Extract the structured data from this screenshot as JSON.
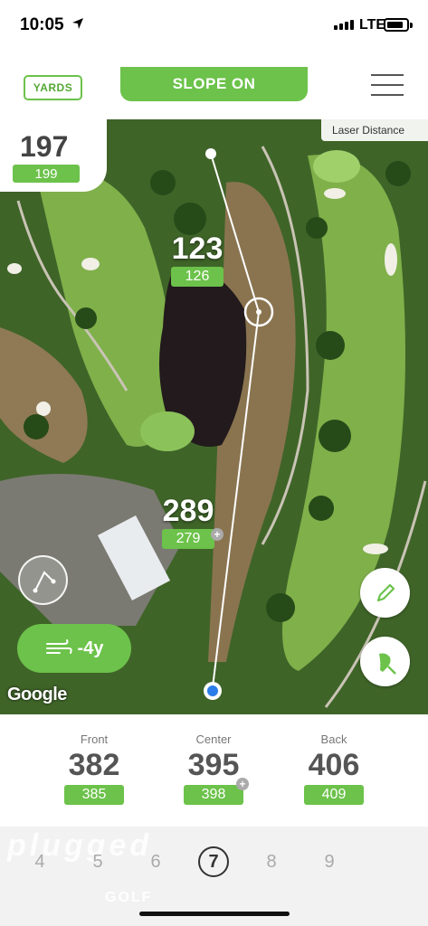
{
  "status_bar": {
    "time": "10:05",
    "network": "LTE"
  },
  "topbar": {
    "units_label": "YARDS",
    "slope_label": "SLOPE ON"
  },
  "map": {
    "laser_label": "Laser Distance",
    "tee_distance": {
      "main": "197",
      "slope": "199"
    },
    "target_distance": {
      "main": "123",
      "slope": "126"
    },
    "player_distance": {
      "main": "289",
      "slope": "279"
    },
    "wind": "-4y",
    "attribution": "Google"
  },
  "yardages": {
    "front": {
      "label": "Front",
      "value": "382",
      "slope": "385"
    },
    "center": {
      "label": "Center",
      "value": "395",
      "slope": "398"
    },
    "back": {
      "label": "Back",
      "value": "406",
      "slope": "409"
    }
  },
  "holes": {
    "items": [
      "4",
      "5",
      "6",
      "7",
      "8",
      "9"
    ],
    "current": "7",
    "watermark": "plugged",
    "watermark_sub": "GOLF"
  },
  "colors": {
    "accent": "#6cc24a",
    "text_dark": "#444444"
  }
}
